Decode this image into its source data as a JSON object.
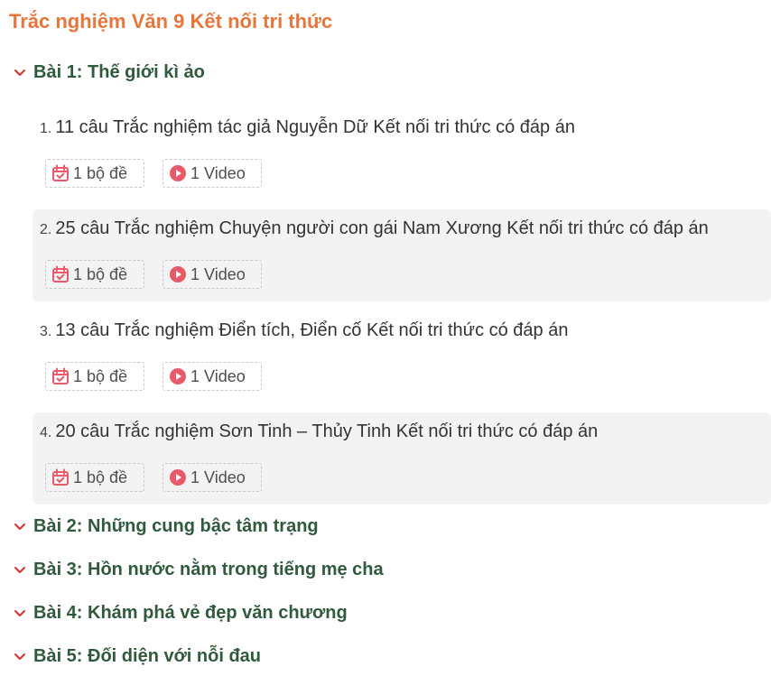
{
  "page": {
    "title": "Trắc nghiệm Văn 9 Kết nối tri thức"
  },
  "colors": {
    "title": "#e8763b",
    "lesson_title": "#2f5a3c",
    "chevron": "#d9302c",
    "badge_icon": "#e85a6a",
    "shaded_row": "#f3f3f3"
  },
  "lessons": [
    {
      "label": "Bài 1: Thế giới kì ảo",
      "expanded": true,
      "icon": "chevron-down-icon",
      "items": [
        {
          "number": "1.",
          "title": "11 câu Trắc nghiệm tác giả Nguyễn Dữ Kết nối tri thức có đáp án",
          "test_label": "1 bộ đề",
          "video_label": "1 Video"
        },
        {
          "number": "2.",
          "title": "25 câu Trắc nghiệm Chuyện người con gái Nam Xương Kết nối tri thức có đáp án",
          "test_label": "1 bộ đề",
          "video_label": "1 Video"
        },
        {
          "number": "3.",
          "title": "13 câu Trắc nghiệm Điển tích, Điển cố Kết nối tri thức có đáp án",
          "test_label": "1 bộ đề",
          "video_label": "1 Video"
        },
        {
          "number": "4.",
          "title": "20 câu Trắc nghiệm Sơn Tinh – Thủy Tinh Kết nối tri thức có đáp án",
          "test_label": "1 bộ đề",
          "video_label": "1 Video"
        }
      ]
    },
    {
      "label": "Bài 2: Những cung bậc tâm trạng",
      "icon": "chevron-down-icon"
    },
    {
      "label": "Bài 3: Hồn nước nằm trong tiếng mẹ cha",
      "icon": "chevron-down-icon"
    },
    {
      "label": "Bài 4: Khám phá vẻ đẹp văn chương",
      "icon": "chevron-down-icon"
    },
    {
      "label": "Bài 5: Đối diện với nỗi đau",
      "icon": "chevron-down-icon"
    }
  ]
}
